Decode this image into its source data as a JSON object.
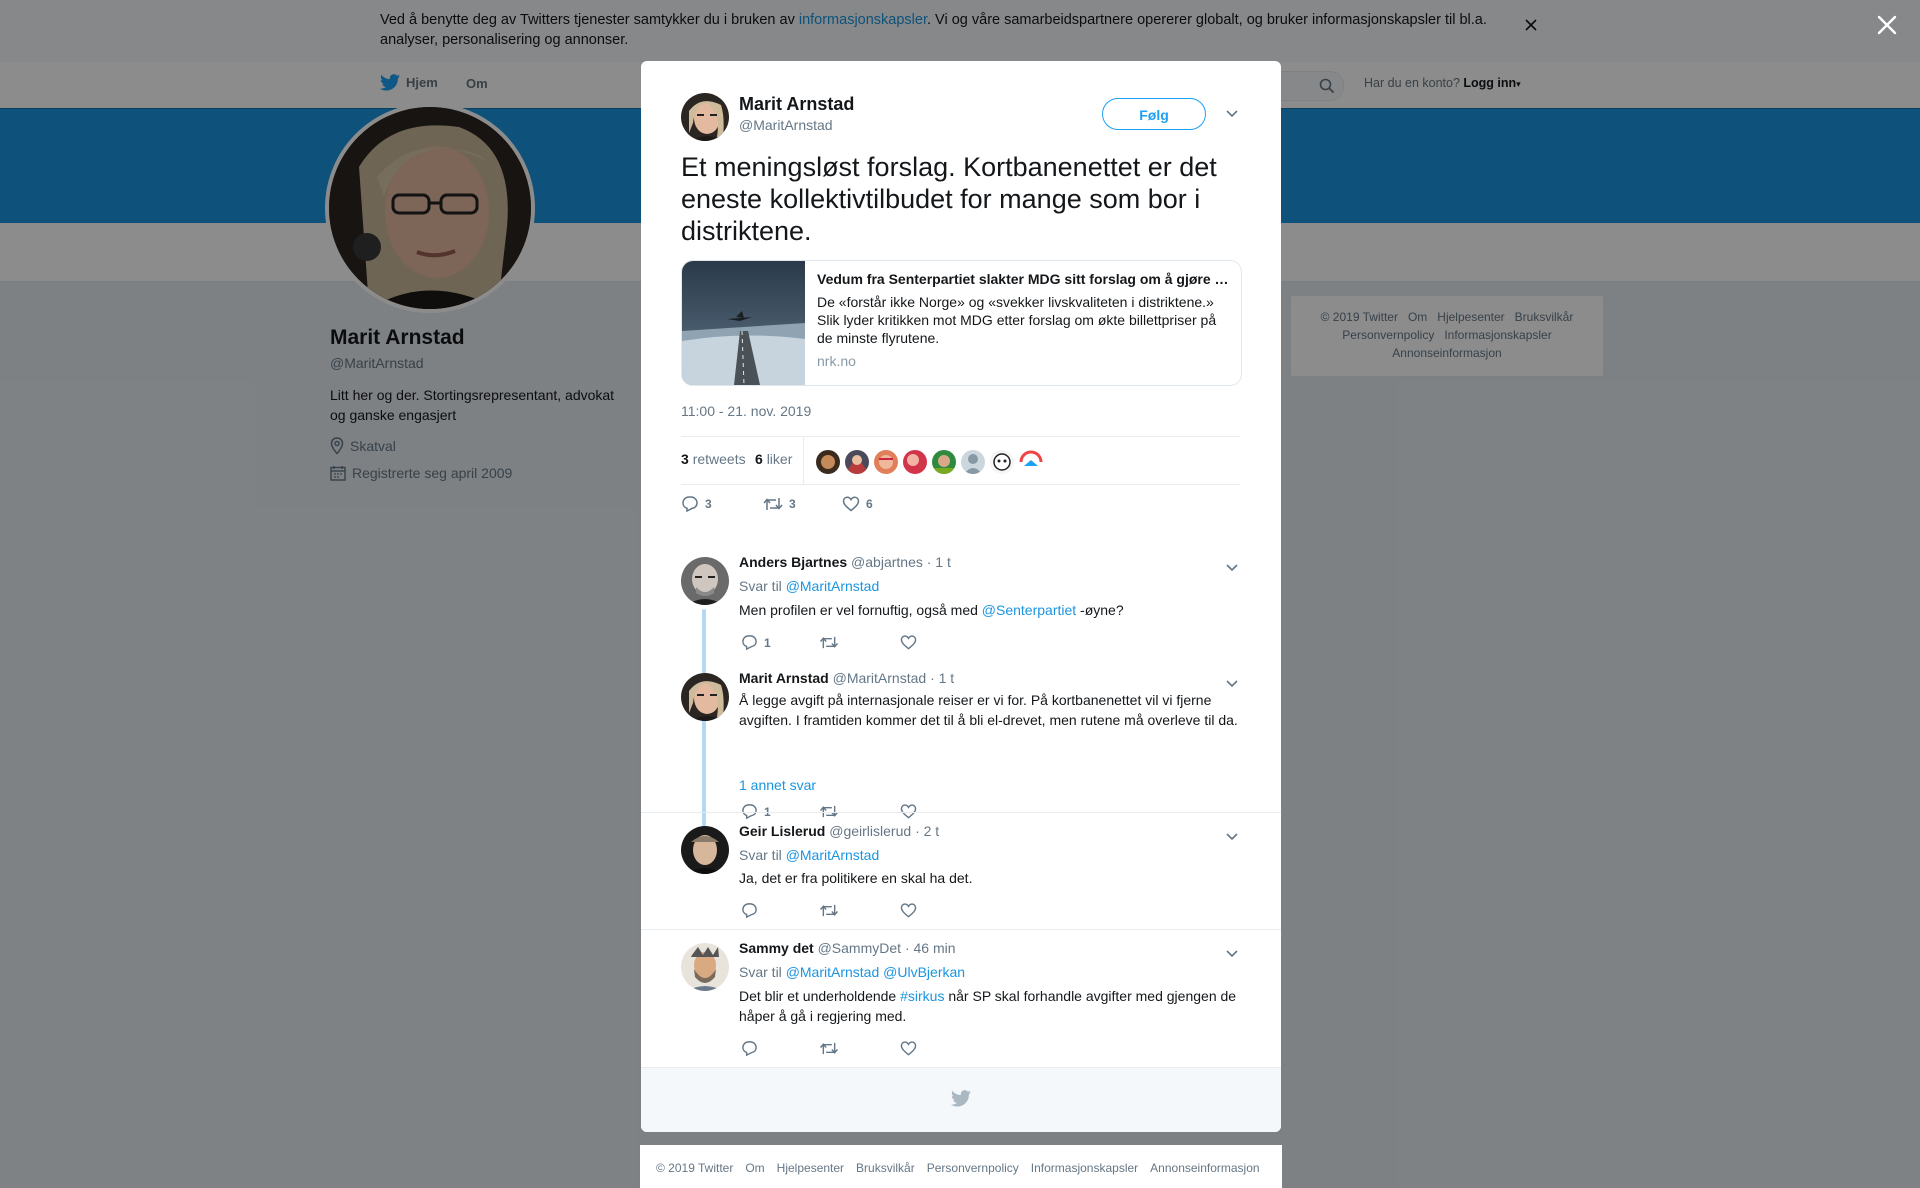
{
  "cookie_bar": {
    "text_before": "Ved å benytte deg av Twitters tjenester samtykker du i bruken av ",
    "link": "informasjonskapsler",
    "text_after": ". Vi og våre samarbeidspartnere opererer globalt, og bruker informasjonskapsler til bl.a. analyser, personalisering og annonser."
  },
  "topnav": {
    "home": "Hjem",
    "about": "Om",
    "account_prompt": "Har du en konto?",
    "login": "Logg inn"
  },
  "profile": {
    "name": "Marit Arnstad",
    "handle": "@MaritArnstad",
    "bio": "Litt her og der. Stortingsrepresentant, advokat og ganske engasjert",
    "location": "Skatval",
    "joined": "Registrerte seg april 2009"
  },
  "side_footer": {
    "items": [
      "© 2019 Twitter",
      "Om",
      "Hjelpesenter",
      "Bruksvilkår",
      "Personvernpolicy",
      "Informasjonskapsler",
      "Annonseinformasjon"
    ]
  },
  "tweet": {
    "name": "Marit Arnstad",
    "handle": "@MaritArnstad",
    "follow_label": "Følg",
    "text": "Et meningsløst forslag. Kortbanenettet er det eneste kollektivtilbudet for mange som bor i distriktene.",
    "card": {
      "title": "Vedum fra Senterpartiet slakter MDG sitt forslag om å gjøre …",
      "description": "De «forstår ikke Norge» og «svekker livskvaliteten i distriktene.» Slik lyder kritikken mot MDG etter forslag om økte billettpriser på de minste flyrutene.",
      "domain": "nrk.no"
    },
    "timestamp": "11:00 - 21. nov. 2019",
    "retweets_count": "3",
    "retweets_label": "retweets",
    "likes_count": "6",
    "likes_label": "liker",
    "actions": {
      "replies": "3",
      "retweets": "3",
      "likes": "6"
    }
  },
  "replies": [
    {
      "name": "Anders Bjartnes",
      "handle": "@abjartnes",
      "time": "· 1 t",
      "reply_to_label": "Svar til",
      "reply_to": "@MaritArnstad",
      "text_before": "Men profilen er vel fornuftig, også med ",
      "mention": "@Senterpartiet",
      "text_after": " -øyne?",
      "reply_count": "1"
    },
    {
      "name": "Marit Arnstad",
      "handle": "@MaritArnstad",
      "time": "· 1 t",
      "text": "Å legge avgift på internasjonale reiser er vi for. På kortbanenettet vil vi fjerne avgiften. I framtiden kommer det til å bli el-drevet, men rutene må overleve til da.",
      "reply_count": "1"
    },
    {
      "name": "Geir Lislerud",
      "handle": "@geirlislerud",
      "time": "· 2 t",
      "reply_to_label": "Svar til",
      "reply_to": "@MaritArnstad",
      "text": "Ja, det er fra politikere en skal ha det."
    },
    {
      "name": "Sammy det",
      "handle": "@SammyDet",
      "time": "· 46 min",
      "reply_to_label": "Svar til",
      "reply_to": "@MaritArnstad @UlvBjerkan",
      "text_before": "Det blir et underholdende ",
      "hashtag": "#sirkus",
      "text_after": " når SP skal forhandle avgifter med gjengen de håper å gå i regjering med."
    }
  ],
  "more_replies": "1 annet svar",
  "bottom_footer": {
    "items": [
      "© 2019 Twitter",
      "Om",
      "Hjelpesenter",
      "Bruksvilkår",
      "Personvernpolicy",
      "Informasjonskapsler",
      "Annonseinformasjon"
    ]
  },
  "colors": {
    "accent": "#1da1f2",
    "link": "#1b95e0",
    "banner": "#1b95e0",
    "thread_line": "#b5d9f3"
  },
  "icons": [
    "twitter-bird-icon",
    "search-icon",
    "close-icon",
    "location-icon",
    "calendar-icon",
    "chevron-down-icon",
    "reply-icon",
    "retweet-icon",
    "heart-icon"
  ]
}
